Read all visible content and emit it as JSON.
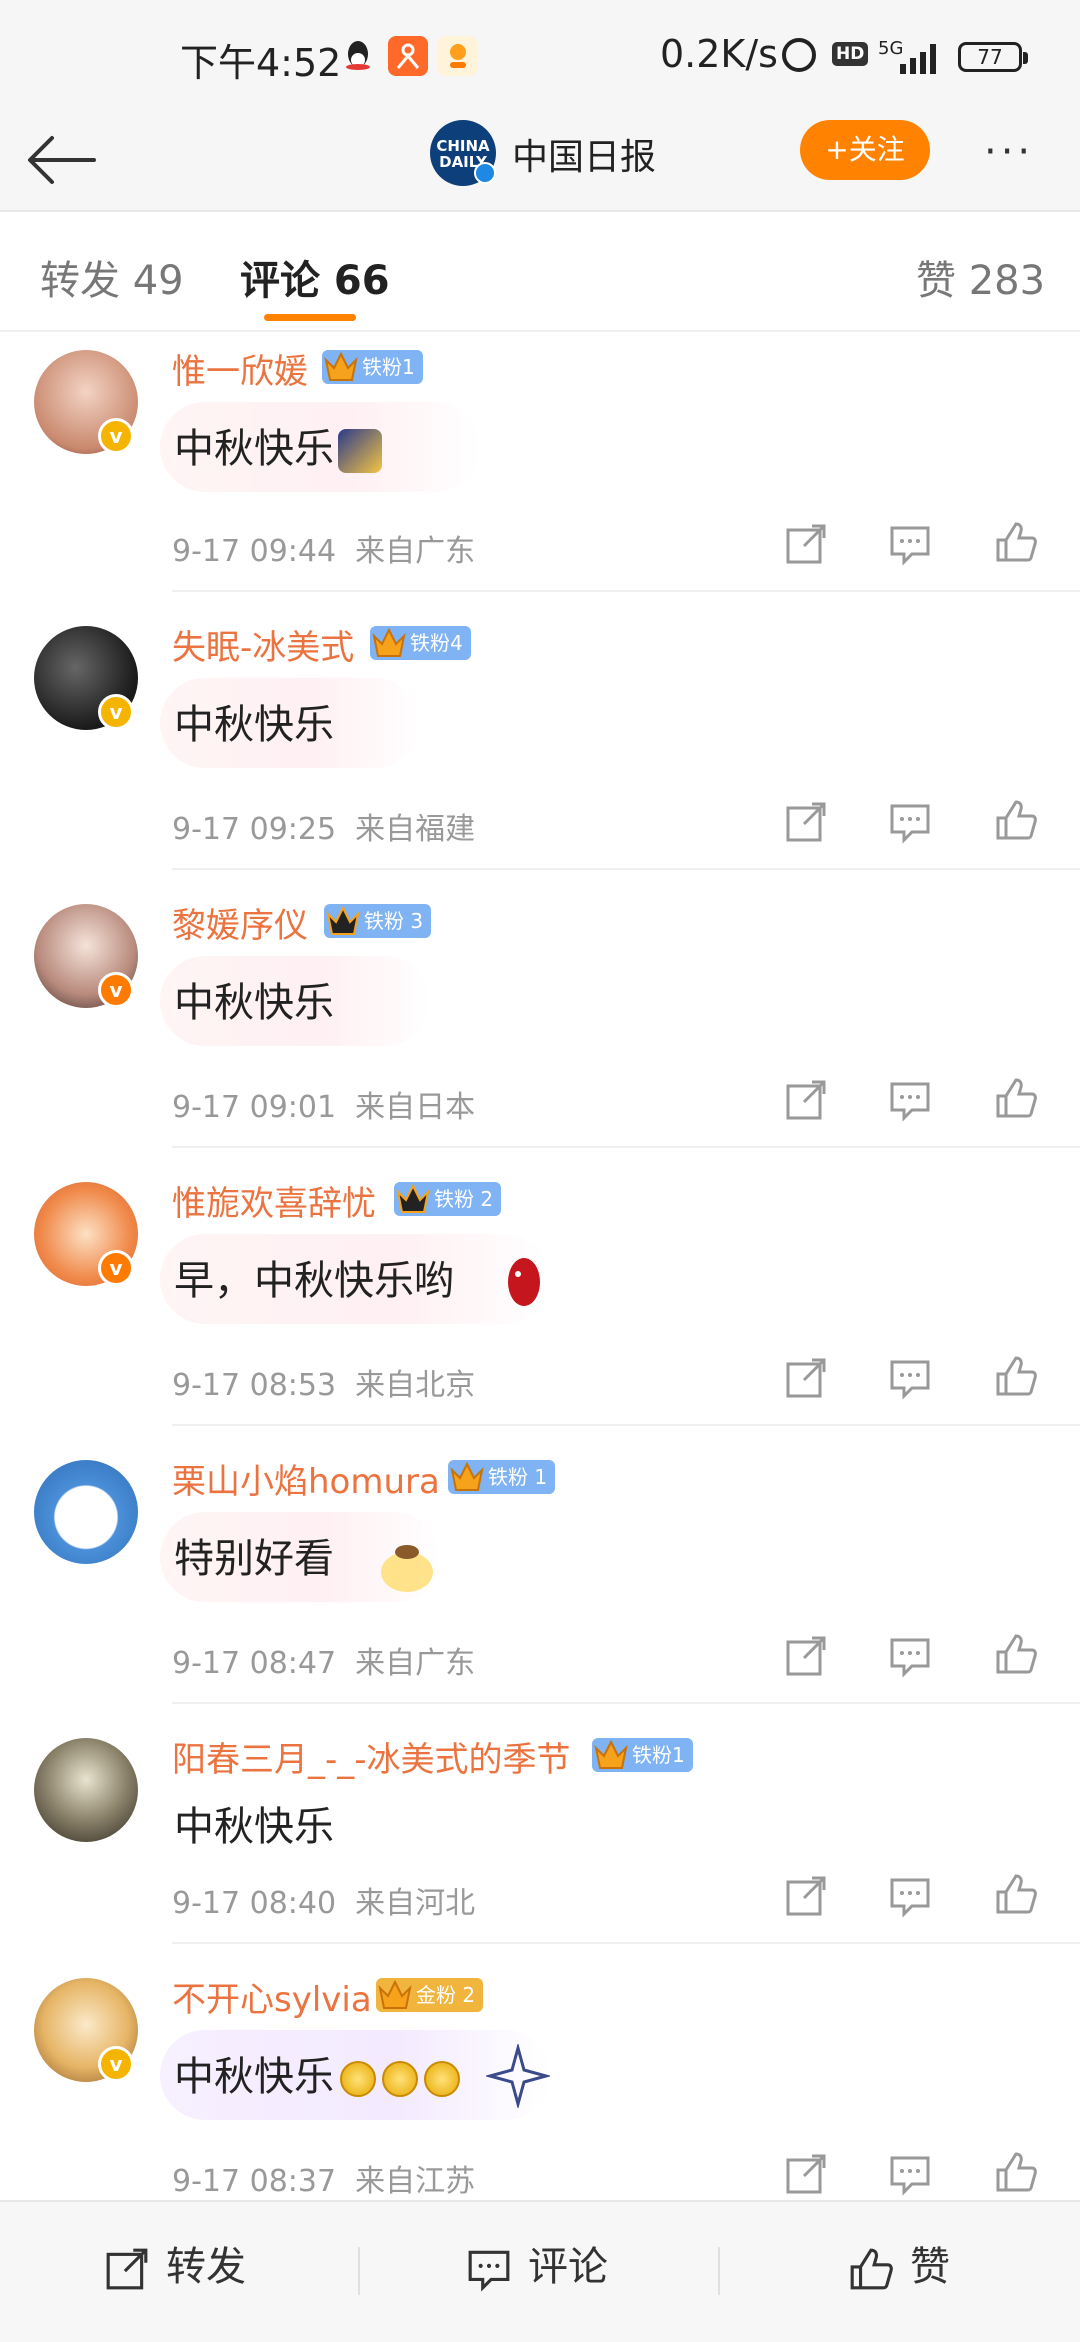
{
  "status_bar": {
    "time": "下午4:52",
    "network_speed": "0.2K/s",
    "hd": "HD",
    "network_type": "5G",
    "battery": "77"
  },
  "header": {
    "account_name": "中国日报",
    "logo_text": "CHINA DAILY",
    "follow_label": "+关注",
    "more_label": "···"
  },
  "tabs": {
    "repost": "转发 49",
    "comments": "评论 66",
    "likes": "赞 283"
  },
  "comments": [
    {
      "name": "惟一欣媛",
      "badge": "铁粉1",
      "text": "中秋快乐",
      "time": "9-17 09:44",
      "location": "来自广东"
    },
    {
      "name": "失眠-冰美式",
      "badge": "铁粉4",
      "text": "中秋快乐",
      "time": "9-17 09:25",
      "location": "来自福建"
    },
    {
      "name": "黎媛序仪",
      "badge": "铁粉 3",
      "text": "中秋快乐",
      "time": "9-17 09:01",
      "location": "来自日本"
    },
    {
      "name": "惟旎欢喜辞忧",
      "badge": "铁粉 2",
      "text": "早，中秋快乐哟",
      "time": "9-17 08:53",
      "location": "来自北京"
    },
    {
      "name": "栗山小焰homura",
      "badge": "铁粉 1",
      "text": "特别好看",
      "time": "9-17 08:47",
      "location": "来自广东"
    },
    {
      "name": "阳春三月_-_-冰美式的季节",
      "badge": "铁粉1",
      "text": "中秋快乐",
      "time": "9-17 08:40",
      "location": "来自河北"
    },
    {
      "name": "不开心sylvia",
      "badge": "金粉 2",
      "text": "中秋快乐",
      "time": "9-17 08:37",
      "location": "来自江苏"
    }
  ],
  "bottom_bar": {
    "repost": "转发",
    "comment": "评论",
    "like": "赞"
  },
  "colors": {
    "accent": "#ff8200",
    "username": "#eb7340",
    "iron_fan_badge": "#7fb3f3",
    "gold_fan_badge": "#f1b53e"
  }
}
